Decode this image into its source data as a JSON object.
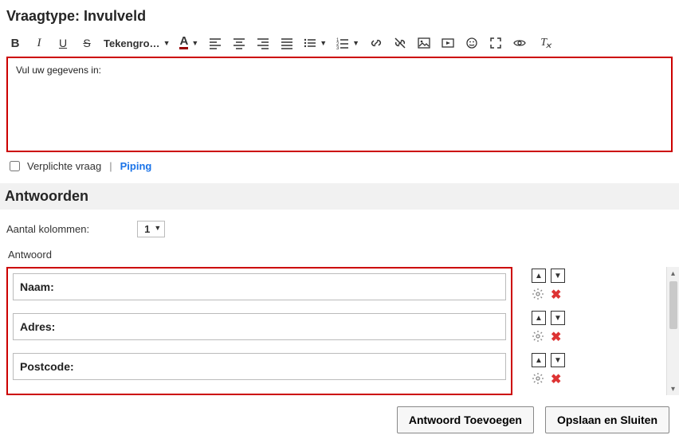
{
  "header": {
    "title": "Vraagtype: Invulveld"
  },
  "toolbar": {
    "font_size_label": "Tekengro…"
  },
  "editor": {
    "content": "Vul uw gegevens in:"
  },
  "options": {
    "required_label": "Verplichte vraag",
    "piping_label": "Piping"
  },
  "answers": {
    "section_title": "Antwoorden",
    "columns_label": "Aantal kolommen:",
    "columns_value": "1",
    "list_header": "Antwoord",
    "items": [
      {
        "value": "Naam:"
      },
      {
        "value": "Adres:"
      },
      {
        "value": "Postcode:"
      }
    ]
  },
  "buttons": {
    "add_answer": "Antwoord Toevoegen",
    "save_close": "Opslaan en Sluiten"
  }
}
